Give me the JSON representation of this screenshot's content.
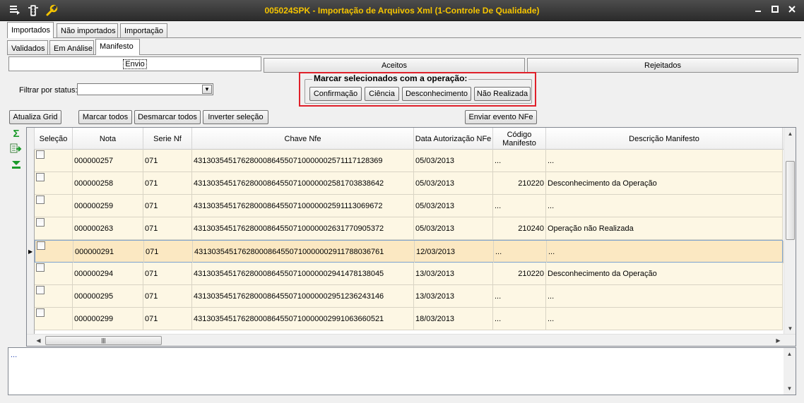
{
  "window": {
    "title": "005024SPK - Importação de Arquivos Xml (1-Controle De Qualidade)",
    "title_color": "#f5c400",
    "icons": [
      "window-menu-icon",
      "traffic-light-icon",
      "wrench-icon"
    ],
    "controls": [
      "minimize",
      "maximize",
      "close"
    ]
  },
  "main_tabs": [
    {
      "label": "Importados",
      "active": true
    },
    {
      "label": "Não importados",
      "active": false
    },
    {
      "label": "Importação",
      "active": false
    }
  ],
  "sub_tabs": [
    {
      "label": "Validados",
      "active": false
    },
    {
      "label": "Em Análise",
      "active": false
    },
    {
      "label": "Manifesto",
      "active": true
    }
  ],
  "manifest_tabs": [
    {
      "label": "Envio",
      "active": true
    },
    {
      "label": "Aceitos",
      "active": false
    },
    {
      "label": "Rejeitados",
      "active": false
    }
  ],
  "filter": {
    "label": "Filtrar por status:",
    "value": ""
  },
  "operation_group": {
    "title": "Marcar selecionados com a operação:",
    "buttons": [
      "Confirmação",
      "Ciência",
      "Desconhecimento",
      "Não Realizada"
    ],
    "highlight_color": "#e0202a"
  },
  "toolbar": {
    "refresh": "Atualiza Grid",
    "mark_all": "Marcar todos",
    "unmark_all": "Desmarcar todos",
    "invert": "Inverter seleção",
    "send_event": "Enviar evento NFe"
  },
  "side_icons": [
    "sum-icon",
    "export-icon",
    "collapse-icon"
  ],
  "grid": {
    "columns": [
      "Seleção",
      "Nota",
      "Serie Nf",
      "Chave Nfe",
      "Data Autorização NFe",
      "Código Manifesto",
      "Descrição Manifesto"
    ],
    "rows": [
      {
        "nota": "000000257",
        "serie": "071",
        "chave": "43130354517628000864550710000002571117128369",
        "data": "05/03/2013",
        "codigo": "...",
        "descricao": "..."
      },
      {
        "nota": "000000258",
        "serie": "071",
        "chave": "43130354517628000864550710000002581703838642",
        "data": "05/03/2013",
        "codigo": "210220",
        "descricao": "Desconhecimento da Operação"
      },
      {
        "nota": "000000259",
        "serie": "071",
        "chave": "43130354517628000864550710000002591113069672",
        "data": "05/03/2013",
        "codigo": "...",
        "descricao": "..."
      },
      {
        "nota": "000000263",
        "serie": "071",
        "chave": "43130354517628000864550710000002631770905372",
        "data": "05/03/2013",
        "codigo": "210240",
        "descricao": "Operação não Realizada"
      },
      {
        "nota": "000000291",
        "serie": "071",
        "chave": "43130354517628000864550710000002911788036761",
        "data": "12/03/2013",
        "codigo": "...",
        "descricao": "...",
        "selected": true
      },
      {
        "nota": "000000294",
        "serie": "071",
        "chave": "43130354517628000864550710000002941478138045",
        "data": "13/03/2013",
        "codigo": "210220",
        "descricao": "Desconhecimento da Operação"
      },
      {
        "nota": "000000295",
        "serie": "071",
        "chave": "43130354517628000864550710000002951236243146",
        "data": "13/03/2013",
        "codigo": "...",
        "descricao": "..."
      },
      {
        "nota": "000000299",
        "serie": "071",
        "chave": "43130354517628000864550710000002991063660521",
        "data": "18/03/2013",
        "codigo": "...",
        "descricao": "..."
      }
    ]
  },
  "memo": {
    "text": "..."
  }
}
